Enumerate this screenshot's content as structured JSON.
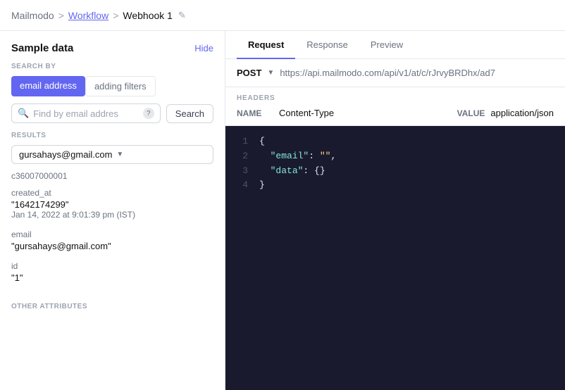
{
  "breadcrumb": {
    "app": "Mailmodo",
    "separator1": ">",
    "workflow": "Workflow",
    "separator2": ">",
    "current": "Webhook 1"
  },
  "left_panel": {
    "title": "Sample data",
    "hide_label": "Hide",
    "search_by_label": "SEARCH BY",
    "filter_tabs": [
      {
        "id": "email",
        "label": "email address",
        "active": true
      },
      {
        "id": "filters",
        "label": "adding filters",
        "active": false
      }
    ],
    "search_placeholder": "Find by email addres",
    "help_tooltip": "?",
    "search_btn": "Search",
    "results_label": "RESULTS",
    "selected_email": "gursahays@gmail.com",
    "contact_id": "c36007000001",
    "fields": [
      {
        "label": "created_at",
        "value": "\"1642174299\"",
        "subvalue": "Jan 14, 2022 at 9:01:39 pm (IST)"
      },
      {
        "label": "email",
        "value": "\"gursahays@gmail.com\"",
        "subvalue": ""
      },
      {
        "label": "id",
        "value": "\"1\"",
        "subvalue": ""
      }
    ],
    "other_attrs_label": "OTHER ATTRIBUTES"
  },
  "right_panel": {
    "tabs": [
      {
        "id": "request",
        "label": "Request",
        "active": true
      },
      {
        "id": "response",
        "label": "Response",
        "active": false
      },
      {
        "id": "preview",
        "label": "Preview",
        "active": false
      }
    ],
    "method": "POST",
    "url": "https://api.mailmodo.com/api/v1/at/c/rJrvyBRDhx/ad7",
    "headers_label": "HEADERS",
    "header_name_col": "NAME",
    "header_name_val": "Content-Type",
    "header_value_col": "VALUE",
    "header_value_val": "application/json",
    "code_lines": [
      {
        "num": "1",
        "content": "{"
      },
      {
        "num": "2",
        "content": "  \"email\": \"\","
      },
      {
        "num": "3",
        "content": "  \"data\": {}"
      },
      {
        "num": "4",
        "content": "}"
      }
    ]
  }
}
